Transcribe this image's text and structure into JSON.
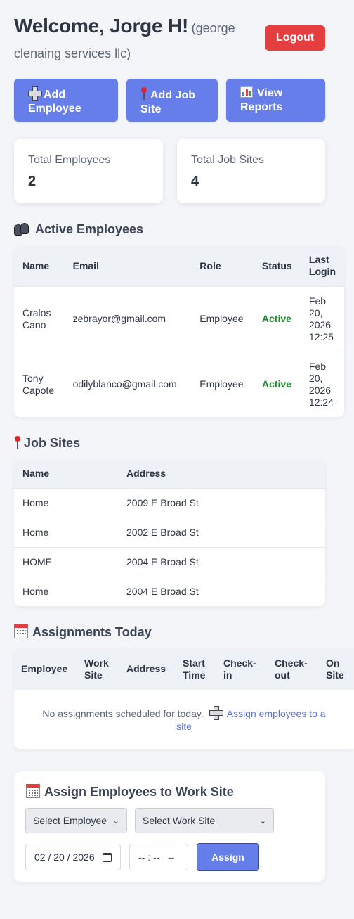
{
  "header": {
    "welcome": "Welcome, Jorge H!",
    "company": "(george clenaing services llc)",
    "logout_label": "Logout"
  },
  "actions": {
    "add_employee": "Add Employee",
    "add_job_site": "Add Job Site",
    "view_reports": "View Reports"
  },
  "stats": [
    {
      "label": "Total Employees",
      "value": "2"
    },
    {
      "label": "Total Job Sites",
      "value": "4"
    }
  ],
  "employees_section": {
    "title": "Active Employees",
    "columns": [
      "Name",
      "Email",
      "Role",
      "Status",
      "Last Login"
    ],
    "rows": [
      {
        "name": "Cralos Cano",
        "email": "zebrayor@gmail.com",
        "role": "Employee",
        "status": "Active",
        "last_login": "Feb 20, 2026 12:25"
      },
      {
        "name": "Tony Capote",
        "email": "odilyblanco@gmail.com",
        "role": "Employee",
        "status": "Active",
        "last_login": "Feb 20, 2026 12:24"
      }
    ]
  },
  "sites_section": {
    "title": "Job Sites",
    "columns": [
      "Name",
      "Address"
    ],
    "rows": [
      {
        "name": "Home",
        "address": "2009 E Broad St"
      },
      {
        "name": "Home",
        "address": "2002 E Broad St"
      },
      {
        "name": "HOME",
        "address": "2004 E Broad St"
      },
      {
        "name": "Home",
        "address": "2004 E Broad St"
      }
    ]
  },
  "assignments_section": {
    "title": "Assignments Today",
    "columns": [
      "Employee",
      "Work Site",
      "Address",
      "Start Time",
      "Check-in",
      "Check-out",
      "On Site"
    ],
    "empty_text": "No assignments scheduled for today.",
    "empty_link": "Assign employees to a site"
  },
  "assign_form": {
    "title": "Assign Employees to Work Site",
    "employee_select": "Select Employee",
    "site_select": "Select Work Site",
    "date_value": "02 / 20 / 2026",
    "time_value": "-- : --   --",
    "submit_label": "Assign"
  },
  "colors": {
    "accent": "#667eea",
    "danger": "#e53e3e",
    "status_active": "#1a8a2c",
    "background": "#f3f5f8"
  }
}
